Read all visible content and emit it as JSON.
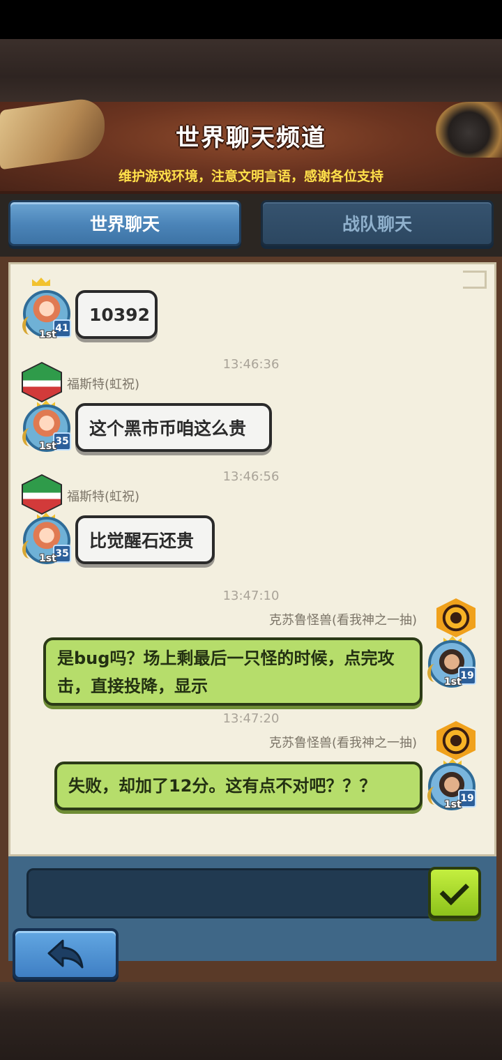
{
  "header": {
    "title": "世界聊天频道",
    "subtitle": "维护游戏环境，注意文明言语，感谢各位支持"
  },
  "tabs": [
    {
      "label": "世界聊天",
      "active": true
    },
    {
      "label": "战队聊天",
      "active": false
    }
  ],
  "messages": [
    {
      "text": "10392",
      "level": "41",
      "rank": "1st",
      "side": "left"
    },
    {
      "time": "13:46:36",
      "sender": "福斯特(虹祝)",
      "text": "这个黑市币咱这么贵",
      "level": "35",
      "rank": "1st",
      "side": "left"
    },
    {
      "time": "13:46:56",
      "sender": "福斯特(虹祝)",
      "text": "比觉醒石还贵",
      "level": "35",
      "rank": "1st",
      "side": "left"
    },
    {
      "time": "13:47:10",
      "sender": "克苏鲁怪兽(看我神之一抽)",
      "text": "是bug吗？场上剩最后一只怪的时候，点完攻击，直接投降，显示",
      "level": "19",
      "rank": "1st",
      "side": "right"
    },
    {
      "time": "13:47:20",
      "sender": "克苏鲁怪兽(看我神之一抽)",
      "text": "失败，却加了12分。这有点不对吧？？？",
      "level": "19",
      "rank": "1st",
      "side": "right"
    }
  ],
  "input": {
    "placeholder": ""
  },
  "icons": {
    "send": "check-icon",
    "back": "back-arrow-icon",
    "guild_left": "guild-flag-icon",
    "guild_right": "guild-eye-icon"
  },
  "colors": {
    "tab_active": "#4a83b7",
    "bubble_self": "#b6dd6b",
    "bubble_other": "#f4f4f2",
    "subtitle": "#ffe04a"
  }
}
